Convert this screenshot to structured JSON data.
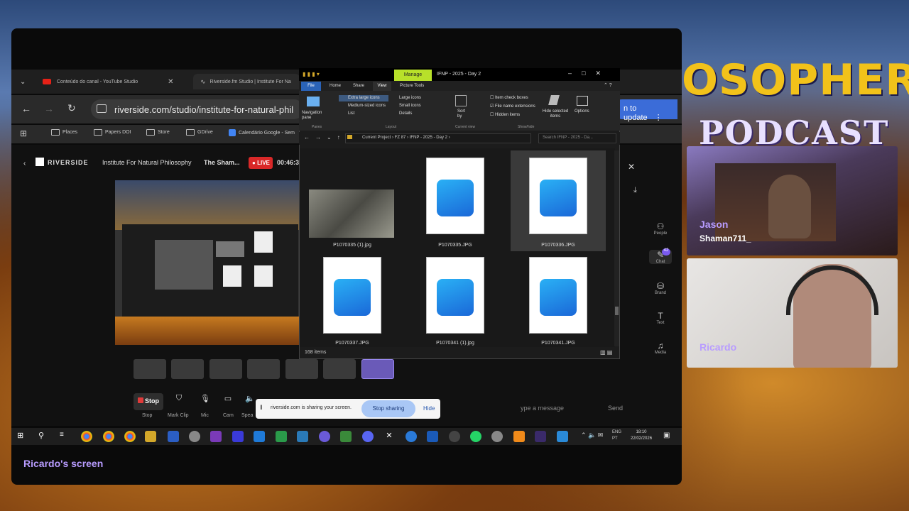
{
  "background": {
    "banner_line1": "OSOPHER",
    "banner_line2": "PODCAST"
  },
  "browser": {
    "tabs": [
      {
        "label": "Conteúdo do canal - YouTube Studio"
      },
      {
        "label": "Riverside.fm Studio | Institute For Na"
      }
    ],
    "url": "riverside.com/studio/institute-for-natural-phil",
    "update_label": "n to update",
    "bookmarks": [
      "Places",
      "Papers DOI",
      "Store",
      "GDrive",
      "Calendário Google - Sem"
    ]
  },
  "riverside": {
    "brand": "RIVERSIDE",
    "org": "Institute For Natural Philosophy",
    "session": "The Sham...",
    "live": "LIVE",
    "timer": "00:46:3",
    "controls": {
      "stop": "Stop",
      "stop_label": "Stop",
      "markclip_label": "Mark Clip",
      "mic_label": "Mic",
      "cam_label": "Cam",
      "speaker_label": "Spea"
    },
    "share_bar": {
      "text": "riverside.com is sharing your screen.",
      "stop_sharing": "Stop sharing",
      "hide": "Hide"
    },
    "chat": {
      "placeholder": "ype a message",
      "send": "Send"
    },
    "side": {
      "people": "People",
      "chat": "Chat",
      "chat_count": "42",
      "brand": "Brand",
      "text": "Text",
      "media": "Media"
    }
  },
  "explorer": {
    "title": "IFNP - 2025 - Day 2",
    "manage": "Manage",
    "picture_tools": "Picture Tools",
    "ribbon_tabs": [
      "File",
      "Home",
      "Share",
      "View"
    ],
    "layout_options": [
      "Extra large icons",
      "Large icons",
      "Medium-sized icons",
      "Small icons",
      "List",
      "Details"
    ],
    "panes": "Navigation pane",
    "sort": "Sort by",
    "checkboxes": [
      "Item check boxes",
      "File name extensions",
      "Hidden items"
    ],
    "hide_selected": "Hide selected items",
    "options": "Options",
    "groups": [
      "Panes",
      "Layout",
      "Current view",
      "Show/hide"
    ],
    "path": [
      "Current Project",
      "FZ 87",
      "IFNP - 2025 - Day 2"
    ],
    "search_placeholder": "Search IFNP - 2025 - Da...",
    "files": [
      {
        "name": "P1070335 (1).jpg",
        "kind": "photo"
      },
      {
        "name": "P1070335.JPG",
        "kind": "icon"
      },
      {
        "name": "P1070336.JPG",
        "kind": "icon",
        "selected": true
      },
      {
        "name": "P1070337.JPG",
        "kind": "icon"
      },
      {
        "name": "P1070341 (1).jpg",
        "kind": "icon"
      },
      {
        "name": "P1070341.JPG",
        "kind": "icon"
      }
    ],
    "status": "168 items"
  },
  "taskbar": {
    "clock_time": "18:10",
    "clock_date": "22/02/2026",
    "lang1": "ENG",
    "lang2": "PT"
  },
  "participants": [
    {
      "name": "Jason",
      "handle": "Shaman711_"
    },
    {
      "name": "Ricardo"
    }
  ],
  "screen_label": "Ricardo's screen",
  "colors": {
    "accent": "#7a5af0",
    "live": "#d92828",
    "manage": "#b8e02a"
  }
}
